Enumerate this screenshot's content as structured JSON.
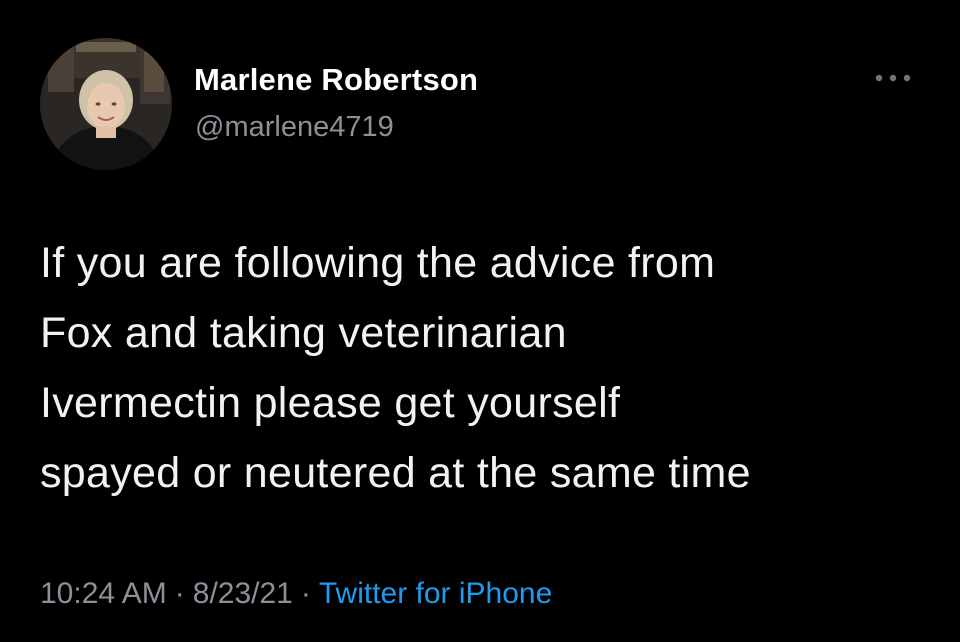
{
  "author": {
    "display_name": "Marlene Robertson",
    "handle": "@marlene4719"
  },
  "tweet": {
    "lines": [
      "If you are following the advice from",
      "Fox and taking veterinarian",
      "Ivermectin please get yourself",
      "spayed or neutered at the same time"
    ],
    "time": "10:24 AM",
    "date": "8/23/21",
    "source": "Twitter for iPhone",
    "separator": "·"
  },
  "icons": {
    "more": "more-horizontal-icon",
    "avatar": "profile-photo"
  },
  "colors": {
    "background": "#000000",
    "text": "#ffffff",
    "secondary_text": "#8b9198",
    "link": "#1d9bf0"
  }
}
